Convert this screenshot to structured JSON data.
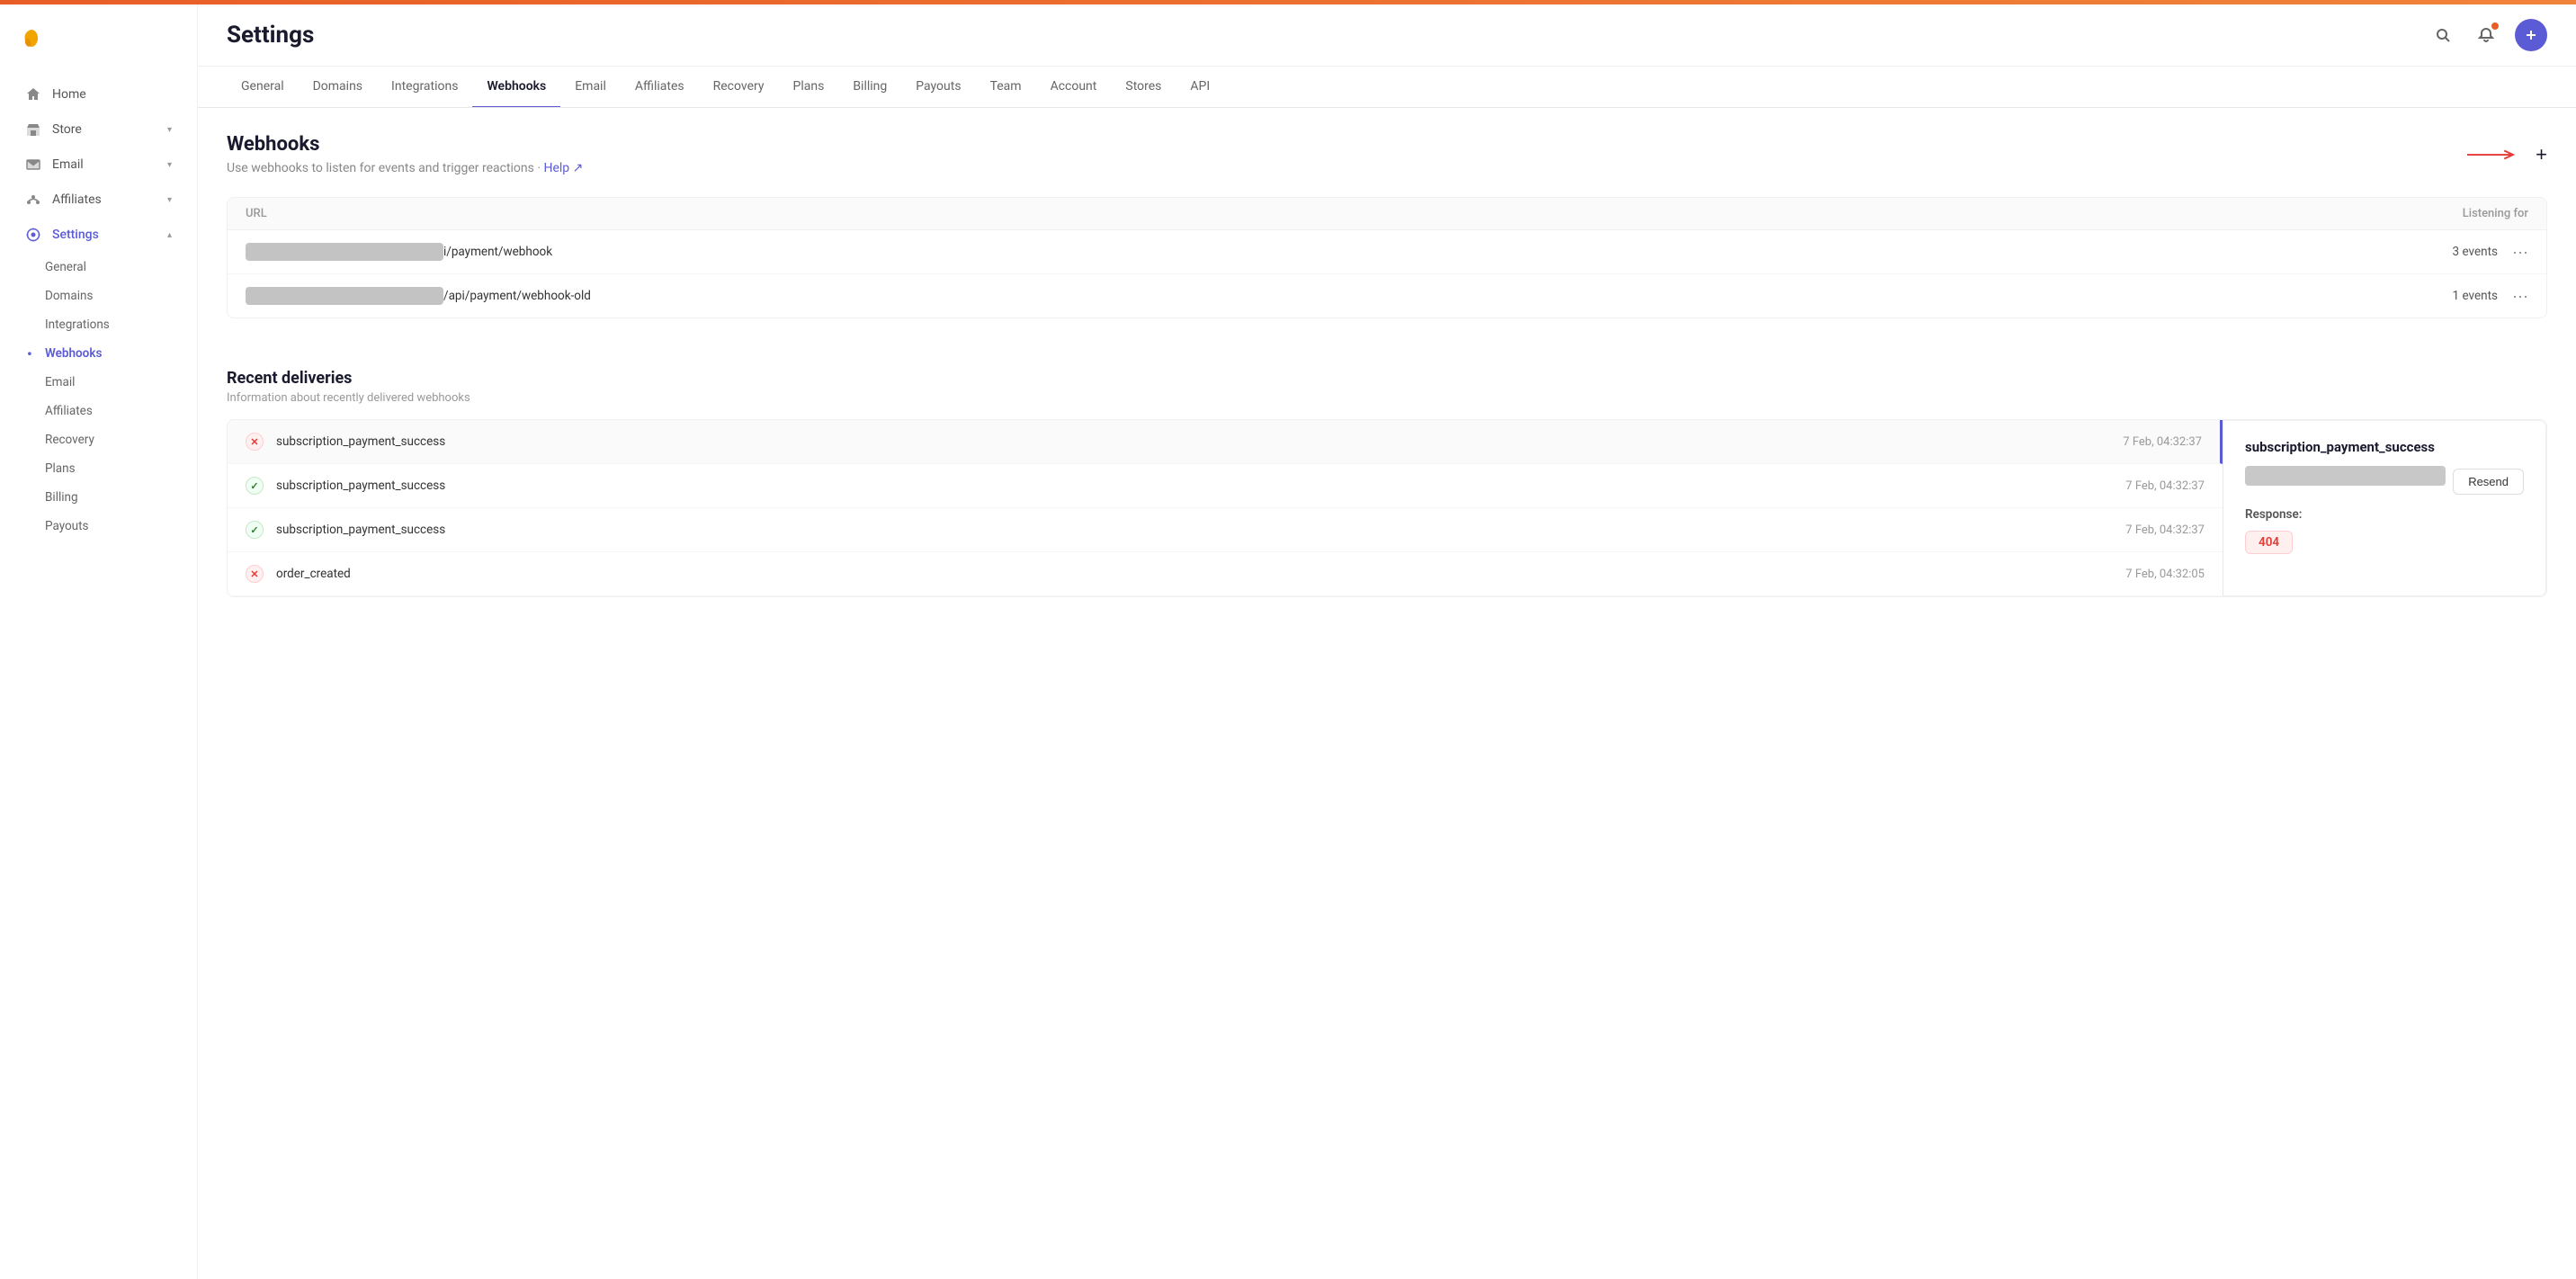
{
  "topbar": {
    "color": "#e85d26"
  },
  "sidebar": {
    "logo_color": "#f0a500",
    "items": [
      {
        "id": "home",
        "label": "Home",
        "icon": "home",
        "active": false
      },
      {
        "id": "store",
        "label": "Store",
        "icon": "store",
        "chevron": true,
        "active": false
      },
      {
        "id": "email",
        "label": "Email",
        "icon": "email",
        "chevron": true,
        "active": false
      },
      {
        "id": "affiliates",
        "label": "Affiliates",
        "icon": "affiliates",
        "chevron": true,
        "active": false
      },
      {
        "id": "settings",
        "label": "Settings",
        "icon": "settings",
        "chevron": true,
        "active": true
      }
    ],
    "sub_items": [
      {
        "id": "general",
        "label": "General",
        "active": false
      },
      {
        "id": "domains",
        "label": "Domains",
        "active": false
      },
      {
        "id": "integrations",
        "label": "Integrations",
        "active": false
      },
      {
        "id": "webhooks",
        "label": "Webhooks",
        "active": true
      },
      {
        "id": "email",
        "label": "Email",
        "active": false
      },
      {
        "id": "affiliates",
        "label": "Affiliates",
        "active": false
      },
      {
        "id": "recovery",
        "label": "Recovery",
        "active": false
      },
      {
        "id": "plans",
        "label": "Plans",
        "active": false
      },
      {
        "id": "billing",
        "label": "Billing",
        "active": false
      },
      {
        "id": "payouts",
        "label": "Payouts",
        "active": false
      }
    ]
  },
  "header": {
    "title": "Settings",
    "search_icon": "search",
    "notification_icon": "bell"
  },
  "tabs": [
    {
      "id": "general",
      "label": "General",
      "active": false
    },
    {
      "id": "domains",
      "label": "Domains",
      "active": false
    },
    {
      "id": "integrations",
      "label": "Integrations",
      "active": false
    },
    {
      "id": "webhooks",
      "label": "Webhooks",
      "active": true
    },
    {
      "id": "email",
      "label": "Email",
      "active": false
    },
    {
      "id": "affiliates",
      "label": "Affiliates",
      "active": false
    },
    {
      "id": "recovery",
      "label": "Recovery",
      "active": false
    },
    {
      "id": "plans",
      "label": "Plans",
      "active": false
    },
    {
      "id": "billing",
      "label": "Billing",
      "active": false
    },
    {
      "id": "payouts",
      "label": "Payouts",
      "active": false
    },
    {
      "id": "team",
      "label": "Team",
      "active": false
    },
    {
      "id": "account",
      "label": "Account",
      "active": false
    },
    {
      "id": "stores",
      "label": "Stores",
      "active": false
    },
    {
      "id": "api",
      "label": "API",
      "active": false
    }
  ],
  "webhooks": {
    "title": "Webhooks",
    "subtitle": "Use webhooks to listen for events and trigger reactions · ",
    "help_label": "Help ↗",
    "add_btn_label": "+",
    "table": {
      "col_url": "URL",
      "col_listening": "Listening for",
      "rows": [
        {
          "id": "row1",
          "url_blur": true,
          "url_suffix": "i/payment/webhook",
          "events": "3 events"
        },
        {
          "id": "row2",
          "url_blur": true,
          "url_suffix": "/api/payment/webhook-old",
          "events": "1 events"
        }
      ]
    }
  },
  "deliveries": {
    "title": "Recent deliveries",
    "subtitle": "Information about recently delivered webhooks",
    "rows": [
      {
        "id": "del1",
        "status": "error",
        "name": "subscription_payment_success",
        "time": "7 Feb, 04:32:37",
        "selected": true
      },
      {
        "id": "del2",
        "status": "success",
        "name": "subscription_payment_success",
        "time": "7 Feb, 04:32:37",
        "selected": false
      },
      {
        "id": "del3",
        "status": "success",
        "name": "subscription_payment_success",
        "time": "7 Feb, 04:32:37",
        "selected": false
      },
      {
        "id": "del4",
        "status": "error",
        "name": "order_created",
        "time": "7 Feb, 04:32:05",
        "selected": false
      }
    ]
  },
  "detail_panel": {
    "event_name": "subscription_payment_success",
    "resend_label": "Resend",
    "response_label": "Response:",
    "response_code": "404"
  }
}
